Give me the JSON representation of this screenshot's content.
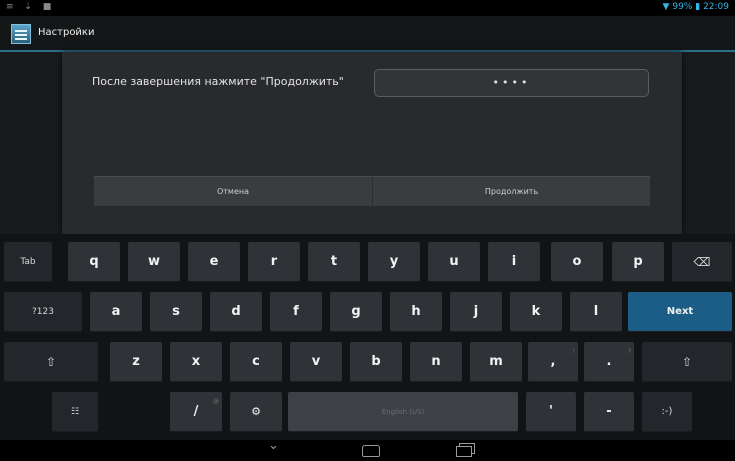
{
  "status_bar": {
    "notification_icons": "≡ ⇣ ■",
    "battery": "99%",
    "time": "22:09"
  },
  "action_bar": {
    "app_icon": "settings-app-icon",
    "title": "Настройки"
  },
  "dialog": {
    "prompt": "После завершения нажмите \"Продолжить\"",
    "password_value": "••••",
    "cancel_label": "Отмена",
    "continue_label": "Продолжить"
  },
  "keyboard": {
    "row1": [
      "Tab",
      "q",
      "w",
      "e",
      "r",
      "t",
      "y",
      "u",
      "i",
      "o",
      "p",
      "⌫"
    ],
    "row2": [
      "?123",
      "a",
      "s",
      "d",
      "f",
      "g",
      "h",
      "j",
      "k",
      "l",
      "Next"
    ],
    "row3": [
      "⇧",
      "z",
      "x",
      "c",
      "v",
      "b",
      "n",
      "m",
      ",",
      ".",
      "⇧"
    ],
    "row3_hints": [
      "!",
      "?"
    ],
    "row4": [
      "☷",
      "/",
      "⚙",
      "English (US)",
      "'",
      "-",
      ":-)"
    ],
    "row4_hints": [
      "@"
    ]
  },
  "nav_bar": {
    "back": "back-icon",
    "home": "home-icon",
    "recents": "recents-icon"
  },
  "colors": {
    "accent": "#33b5e5",
    "next_key": "#1b5d86",
    "keyboard_bg": "#111315"
  }
}
